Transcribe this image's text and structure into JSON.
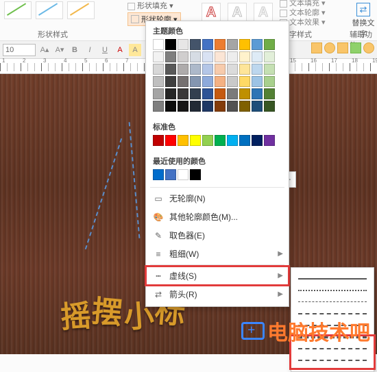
{
  "ribbon": {
    "shape_styles_label": "形状样式",
    "wordart_label": "艺术字样式",
    "aux_label": "辅助功能",
    "shape_fill_label": "形状填充",
    "shape_outline_label": "形状轮廓",
    "text_fill_label": "文本填充",
    "text_outline_label": "文本轮廓",
    "text_effect_label": "文本效果",
    "replace_label": "替换文字",
    "wordart_sample": "A"
  },
  "mini": {
    "font_size": "10"
  },
  "dropdown": {
    "theme_label": "主题颜色",
    "standard_label": "标准色",
    "recent_label": "最近使用的颜色",
    "no_outline_label": "无轮廓(N)",
    "more_colors_label": "其他轮廓颜色(M)...",
    "eyedropper_label": "取色器(E)",
    "weight_label": "粗细(W)",
    "dashes_label": "虚线(S)",
    "arrows_label": "箭头(R)",
    "theme_colors": [
      "#ffffff",
      "#000000",
      "#e7e6e6",
      "#44546a",
      "#4472c4",
      "#ed7d31",
      "#a5a5a5",
      "#ffc000",
      "#5b9bd5",
      "#70ad47",
      "#f2f2f2",
      "#7f7f7f",
      "#d0cece",
      "#d6dce4",
      "#d9e2f3",
      "#fbe5d5",
      "#ededed",
      "#fff2cc",
      "#deebf6",
      "#e2efd9",
      "#d8d8d8",
      "#595959",
      "#aeabab",
      "#adb9ca",
      "#b4c6e7",
      "#f7cbac",
      "#dbdbdb",
      "#fee599",
      "#bdd7ee",
      "#c5e0b3",
      "#bfbfbf",
      "#3f3f3f",
      "#757070",
      "#8496b0",
      "#8eaadb",
      "#f4b183",
      "#c9c9c9",
      "#ffd965",
      "#9cc3e5",
      "#a8d08d",
      "#a5a5a5",
      "#262626",
      "#3a3838",
      "#323f4f",
      "#2f5496",
      "#c55a11",
      "#7b7b7b",
      "#bf9000",
      "#2e75b5",
      "#538135",
      "#7f7f7f",
      "#0c0c0c",
      "#171616",
      "#222a35",
      "#1f3864",
      "#833c0b",
      "#525252",
      "#7f6000",
      "#1e4e79",
      "#375623"
    ],
    "standard_colors": [
      "#c00000",
      "#ff0000",
      "#ffc000",
      "#ffff00",
      "#92d050",
      "#00b050",
      "#00b0f0",
      "#0070c0",
      "#002060",
      "#7030a0"
    ],
    "recent_colors": [
      "#006ccc",
      "#4472c4",
      "#ffffff",
      "#000000"
    ]
  },
  "submenu": {
    "options": [
      "solid",
      "round-dot",
      "square-dot",
      "dash",
      "dash-dot",
      "long-dash",
      "long-dash-dot",
      "long-dash-dot-dot"
    ]
  },
  "canvas": {
    "gold_text": "摇摆小标",
    "plus": "+"
  },
  "watermark": {
    "text": "电脑技术吧"
  }
}
